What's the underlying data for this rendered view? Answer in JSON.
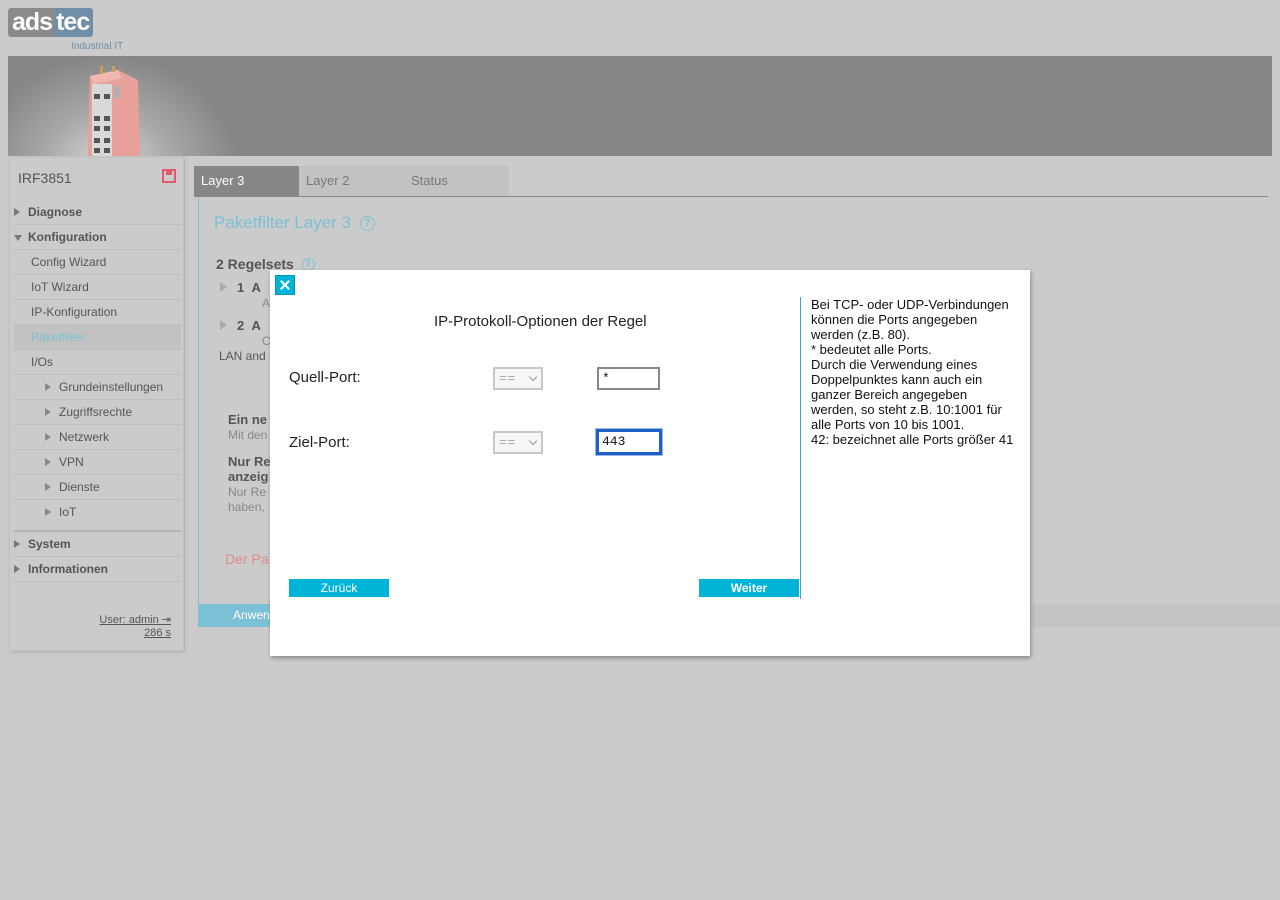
{
  "brand": {
    "logo_left": "ads",
    "logo_right": "tec",
    "tagline": "Industrial IT"
  },
  "sidebar": {
    "device_name": "IRF3851",
    "items": [
      {
        "label": "Diagnose",
        "level": "top",
        "expanded": false
      },
      {
        "label": "Konfiguration",
        "level": "top",
        "expanded": true
      },
      {
        "label": "Config Wizard",
        "level": "sub"
      },
      {
        "label": "IoT Wizard",
        "level": "sub"
      },
      {
        "label": "IP-Konfiguration",
        "level": "sub"
      },
      {
        "label": "Paketfilter",
        "level": "sub",
        "active": true
      },
      {
        "label": "I/Os",
        "level": "sub"
      },
      {
        "label": "Grundeinstellungen",
        "level": "subsub"
      },
      {
        "label": "Zugriffsrechte",
        "level": "subsub"
      },
      {
        "label": "Netzwerk",
        "level": "subsub"
      },
      {
        "label": "VPN",
        "level": "subsub"
      },
      {
        "label": "Dienste",
        "level": "subsub"
      },
      {
        "label": "IoT",
        "level": "subsub"
      },
      {
        "label": "System",
        "level": "top",
        "expanded": false
      },
      {
        "label": "Informationen",
        "level": "top",
        "expanded": false
      }
    ],
    "user_label": "User: admin",
    "session_time": "286 s"
  },
  "tabs": [
    {
      "label": "Layer 3",
      "active": true
    },
    {
      "label": "Layer 2",
      "active": false
    },
    {
      "label": "Status",
      "active": false
    }
  ],
  "main": {
    "page_title": "Paketfilter Layer 3",
    "help_glyph": "?",
    "rulesets_title": "2 Regelsets",
    "rulesets": [
      {
        "num": "1",
        "letter": "A",
        "sub": "A"
      },
      {
        "num": "2",
        "letter": "A",
        "sub": "C"
      }
    ],
    "fragment_lan": "LAN and",
    "fragment_new_title": "Ein ne",
    "fragment_new_text": "Mit den",
    "fragment_only_title_1": "Nur Re",
    "fragment_only_title_2": "anzeig",
    "fragment_only_text_1": "Nur Re",
    "fragment_only_text_2": "haben,",
    "fragment_red": "Der Pa",
    "apply_label": "Anwen"
  },
  "modal": {
    "title": "IP-Protokoll-Optionen der Regel",
    "source_port_label": "Quell-Port:",
    "source_operator": "==",
    "source_port_value": "*",
    "dest_port_label": "Ziel-Port:",
    "dest_operator": "==",
    "dest_port_value": "443",
    "back_label": "Zurück",
    "next_label": "Weiter",
    "info_lines": [
      "Bei TCP- oder UDP-Verbindungen können die Ports angegeben werden (z.B. 80).",
      "* bedeutet alle Ports.",
      "Durch die Verwendung eines Doppelpunktes kann auch ein ganzer Bereich angegeben werden, so steht z.B. 10:1001 für alle Ports von 10 bis 1001.",
      "42: bezeichnet alle Ports größer 41"
    ]
  },
  "colors": {
    "accent": "#00b4d8",
    "link_blue": "#7cc0d6",
    "warning_red": "#e05a6a",
    "background": "#cbcbcb"
  }
}
